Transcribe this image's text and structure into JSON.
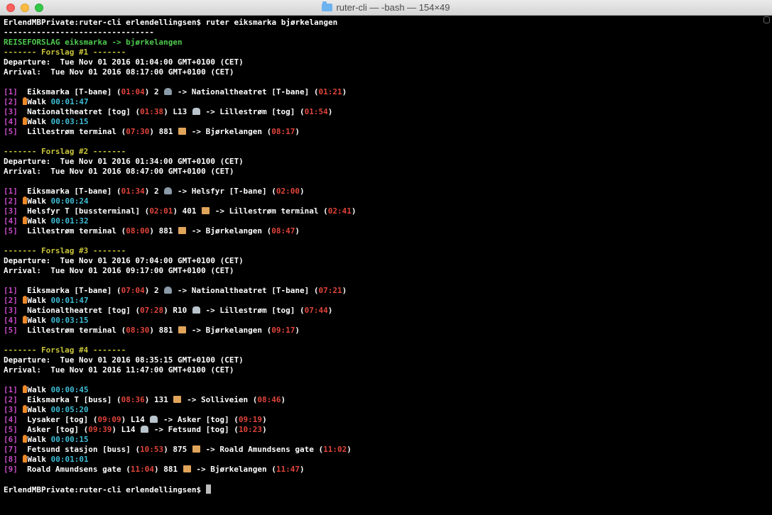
{
  "window": {
    "title": "ruter-cli — -bash — 154×49"
  },
  "terminal": {
    "lines": [
      [
        [
          "w",
          "ErlendMBPrivate:ruter-cli erlendellingsen$ ruter eiksmarka bjørkelangen"
        ]
      ],
      [
        [
          "w",
          "--------------------------------"
        ]
      ],
      [
        [
          "g",
          "REISEFORSLAG eiksmarka -> bjørkelangen"
        ]
      ],
      [
        [
          "y",
          "------- Forslag #1 -------"
        ]
      ],
      [
        [
          "w",
          "Departure:  Tue Nov 01 2016 01:04:00 GMT+0100 (CET)"
        ]
      ],
      [
        [
          "w",
          "Arrival:  Tue Nov 01 2016 08:17:00 GMT+0100 (CET)"
        ]
      ],
      [],
      [
        [
          "m",
          "[1]"
        ],
        [
          "w",
          "  Eiksmarka [T-bane] ("
        ],
        [
          "r",
          "01:04"
        ],
        [
          "w",
          ") 2 "
        ],
        [
          "icon",
          "metro-icon"
        ],
        [
          "w",
          " -> Nationaltheatret [T-bane] ("
        ],
        [
          "r",
          "01:21"
        ],
        [
          "w",
          ")"
        ]
      ],
      [
        [
          "m",
          "[2]"
        ],
        [
          "w",
          " "
        ],
        [
          "icon",
          "walk-icon"
        ],
        [
          "w",
          "Walk "
        ],
        [
          "c",
          "00:01:47"
        ]
      ],
      [
        [
          "m",
          "[3]"
        ],
        [
          "w",
          "  Nationaltheatret [tog] ("
        ],
        [
          "r",
          "01:38"
        ],
        [
          "w",
          ") L13 "
        ],
        [
          "icon",
          "train-icon"
        ],
        [
          "w",
          " -> Lillestrøm [tog] ("
        ],
        [
          "r",
          "01:54"
        ],
        [
          "w",
          ")"
        ]
      ],
      [
        [
          "m",
          "[4]"
        ],
        [
          "w",
          " "
        ],
        [
          "icon",
          "walk-icon"
        ],
        [
          "w",
          "Walk "
        ],
        [
          "c",
          "00:03:15"
        ]
      ],
      [
        [
          "m",
          "[5]"
        ],
        [
          "w",
          "  Lillestrøm terminal ("
        ],
        [
          "r",
          "07:30"
        ],
        [
          "w",
          ") 881 "
        ],
        [
          "icon",
          "bus-icon"
        ],
        [
          "w",
          " -> Bjørkelangen ("
        ],
        [
          "r",
          "08:17"
        ],
        [
          "w",
          ")"
        ]
      ],
      [],
      [
        [
          "y",
          "------- Forslag #2 -------"
        ]
      ],
      [
        [
          "w",
          "Departure:  Tue Nov 01 2016 01:34:00 GMT+0100 (CET)"
        ]
      ],
      [
        [
          "w",
          "Arrival:  Tue Nov 01 2016 08:47:00 GMT+0100 (CET)"
        ]
      ],
      [],
      [
        [
          "m",
          "[1]"
        ],
        [
          "w",
          "  Eiksmarka [T-bane] ("
        ],
        [
          "r",
          "01:34"
        ],
        [
          "w",
          ") 2 "
        ],
        [
          "icon",
          "metro-icon"
        ],
        [
          "w",
          " -> Helsfyr [T-bane] ("
        ],
        [
          "r",
          "02:00"
        ],
        [
          "w",
          ")"
        ]
      ],
      [
        [
          "m",
          "[2]"
        ],
        [
          "w",
          " "
        ],
        [
          "icon",
          "walk-icon"
        ],
        [
          "w",
          "Walk "
        ],
        [
          "c",
          "00:00:24"
        ]
      ],
      [
        [
          "m",
          "[3]"
        ],
        [
          "w",
          "  Helsfyr T [bussterminal] ("
        ],
        [
          "r",
          "02:01"
        ],
        [
          "w",
          ") 401 "
        ],
        [
          "icon",
          "bus-icon"
        ],
        [
          "w",
          " -> Lillestrøm terminal ("
        ],
        [
          "r",
          "02:41"
        ],
        [
          "w",
          ")"
        ]
      ],
      [
        [
          "m",
          "[4]"
        ],
        [
          "w",
          " "
        ],
        [
          "icon",
          "walk-icon"
        ],
        [
          "w",
          "Walk "
        ],
        [
          "c",
          "00:01:32"
        ]
      ],
      [
        [
          "m",
          "[5]"
        ],
        [
          "w",
          "  Lillestrøm terminal ("
        ],
        [
          "r",
          "08:00"
        ],
        [
          "w",
          ") 881 "
        ],
        [
          "icon",
          "bus-icon"
        ],
        [
          "w",
          " -> Bjørkelangen ("
        ],
        [
          "r",
          "08:47"
        ],
        [
          "w",
          ")"
        ]
      ],
      [],
      [
        [
          "y",
          "------- Forslag #3 -------"
        ]
      ],
      [
        [
          "w",
          "Departure:  Tue Nov 01 2016 07:04:00 GMT+0100 (CET)"
        ]
      ],
      [
        [
          "w",
          "Arrival:  Tue Nov 01 2016 09:17:00 GMT+0100 (CET)"
        ]
      ],
      [],
      [
        [
          "m",
          "[1]"
        ],
        [
          "w",
          "  Eiksmarka [T-bane] ("
        ],
        [
          "r",
          "07:04"
        ],
        [
          "w",
          ") 2 "
        ],
        [
          "icon",
          "metro-icon"
        ],
        [
          "w",
          " -> Nationaltheatret [T-bane] ("
        ],
        [
          "r",
          "07:21"
        ],
        [
          "w",
          ")"
        ]
      ],
      [
        [
          "m",
          "[2]"
        ],
        [
          "w",
          " "
        ],
        [
          "icon",
          "walk-icon"
        ],
        [
          "w",
          "Walk "
        ],
        [
          "c",
          "00:01:47"
        ]
      ],
      [
        [
          "m",
          "[3]"
        ],
        [
          "w",
          "  Nationaltheatret [tog] ("
        ],
        [
          "r",
          "07:28"
        ],
        [
          "w",
          ") R10 "
        ],
        [
          "icon",
          "train-icon"
        ],
        [
          "w",
          " -> Lillestrøm [tog] ("
        ],
        [
          "r",
          "07:44"
        ],
        [
          "w",
          ")"
        ]
      ],
      [
        [
          "m",
          "[4]"
        ],
        [
          "w",
          " "
        ],
        [
          "icon",
          "walk-icon"
        ],
        [
          "w",
          "Walk "
        ],
        [
          "c",
          "00:03:15"
        ]
      ],
      [
        [
          "m",
          "[5]"
        ],
        [
          "w",
          "  Lillestrøm terminal ("
        ],
        [
          "r",
          "08:30"
        ],
        [
          "w",
          ") 881 "
        ],
        [
          "icon",
          "bus-icon"
        ],
        [
          "w",
          " -> Bjørkelangen ("
        ],
        [
          "r",
          "09:17"
        ],
        [
          "w",
          ")"
        ]
      ],
      [],
      [
        [
          "y",
          "------- Forslag #4 -------"
        ]
      ],
      [
        [
          "w",
          "Departure:  Tue Nov 01 2016 08:35:15 GMT+0100 (CET)"
        ]
      ],
      [
        [
          "w",
          "Arrival:  Tue Nov 01 2016 11:47:00 GMT+0100 (CET)"
        ]
      ],
      [],
      [
        [
          "m",
          "[1]"
        ],
        [
          "w",
          " "
        ],
        [
          "icon",
          "walk-icon"
        ],
        [
          "w",
          "Walk "
        ],
        [
          "c",
          "00:00:45"
        ]
      ],
      [
        [
          "m",
          "[2]"
        ],
        [
          "w",
          "  Eiksmarka T [buss] ("
        ],
        [
          "r",
          "08:36"
        ],
        [
          "w",
          ") 131 "
        ],
        [
          "icon",
          "bus-icon"
        ],
        [
          "w",
          " -> Solliveien ("
        ],
        [
          "r",
          "08:46"
        ],
        [
          "w",
          ")"
        ]
      ],
      [
        [
          "m",
          "[3]"
        ],
        [
          "w",
          " "
        ],
        [
          "icon",
          "walk-icon"
        ],
        [
          "w",
          "Walk "
        ],
        [
          "c",
          "00:05:20"
        ]
      ],
      [
        [
          "m",
          "[4]"
        ],
        [
          "w",
          "  Lysaker [tog] ("
        ],
        [
          "r",
          "09:09"
        ],
        [
          "w",
          ") L14 "
        ],
        [
          "icon",
          "train-icon"
        ],
        [
          "w",
          " -> Asker [tog] ("
        ],
        [
          "r",
          "09:19"
        ],
        [
          "w",
          ")"
        ]
      ],
      [
        [
          "m",
          "[5]"
        ],
        [
          "w",
          "  Asker [tog] ("
        ],
        [
          "r",
          "09:39"
        ],
        [
          "w",
          ") L14 "
        ],
        [
          "icon",
          "train-icon"
        ],
        [
          "w",
          " -> Fetsund [tog] ("
        ],
        [
          "r",
          "10:23"
        ],
        [
          "w",
          ")"
        ]
      ],
      [
        [
          "m",
          "[6]"
        ],
        [
          "w",
          " "
        ],
        [
          "icon",
          "walk-icon"
        ],
        [
          "w",
          "Walk "
        ],
        [
          "c",
          "00:00:15"
        ]
      ],
      [
        [
          "m",
          "[7]"
        ],
        [
          "w",
          "  Fetsund stasjon [buss] ("
        ],
        [
          "r",
          "10:53"
        ],
        [
          "w",
          ") 875 "
        ],
        [
          "icon",
          "bus-icon"
        ],
        [
          "w",
          " -> Roald Amundsens gate ("
        ],
        [
          "r",
          "11:02"
        ],
        [
          "w",
          ")"
        ]
      ],
      [
        [
          "m",
          "[8]"
        ],
        [
          "w",
          " "
        ],
        [
          "icon",
          "walk-icon"
        ],
        [
          "w",
          "Walk "
        ],
        [
          "c",
          "00:01:01"
        ]
      ],
      [
        [
          "m",
          "[9]"
        ],
        [
          "w",
          "  Roald Amundsens gate ("
        ],
        [
          "r",
          "11:04"
        ],
        [
          "w",
          ") 881 "
        ],
        [
          "icon",
          "bus-icon"
        ],
        [
          "w",
          " -> Bjørkelangen ("
        ],
        [
          "r",
          "11:47"
        ],
        [
          "w",
          ")"
        ]
      ],
      [],
      [
        [
          "w",
          "ErlendMBPrivate:ruter-cli erlendellingsen$ "
        ],
        [
          "cursor",
          ""
        ]
      ]
    ]
  }
}
